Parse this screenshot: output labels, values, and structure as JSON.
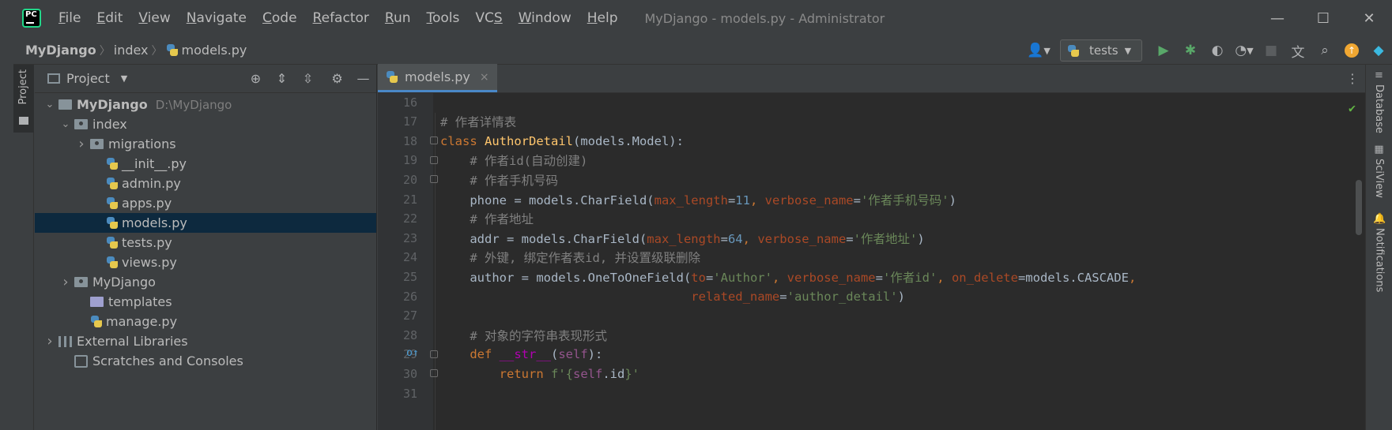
{
  "window": {
    "title": "MyDjango - models.py - Administrator",
    "controls": {
      "minimize": "—",
      "maximize": "☐",
      "close": "✕"
    }
  },
  "menu": [
    {
      "u": "F",
      "rest": "ile"
    },
    {
      "u": "E",
      "rest": "dit"
    },
    {
      "u": "V",
      "rest": "iew"
    },
    {
      "u": "N",
      "rest": "avigate"
    },
    {
      "u": "C",
      "rest": "ode"
    },
    {
      "u": "R",
      "rest": "efactor"
    },
    {
      "u": "R",
      "rest": "un"
    },
    {
      "u": "T",
      "rest": "ools"
    },
    {
      "pre": "VC",
      "u": "S",
      "rest": ""
    },
    {
      "u": "W",
      "rest": "indow"
    },
    {
      "u": "H",
      "rest": "elp"
    }
  ],
  "breadcrumb": {
    "project": "MyDjango",
    "folder": "index",
    "file": "models.py"
  },
  "run_config": {
    "label": "tests"
  },
  "left_strip": {
    "project_tab": "Project"
  },
  "project_panel": {
    "title": "Project",
    "tree": [
      {
        "indent": 0,
        "arrow": "down",
        "icon": "folder",
        "label": "MyDjango",
        "path": "D:\\MyDjango",
        "bold": true
      },
      {
        "indent": 1,
        "arrow": "down",
        "icon": "pkg",
        "label": "index"
      },
      {
        "indent": 2,
        "arrow": "right",
        "icon": "pkg",
        "label": "migrations"
      },
      {
        "indent": 3,
        "arrow": "",
        "icon": "py",
        "label": "__init__.py"
      },
      {
        "indent": 3,
        "arrow": "",
        "icon": "py",
        "label": "admin.py"
      },
      {
        "indent": 3,
        "arrow": "",
        "icon": "py",
        "label": "apps.py"
      },
      {
        "indent": 3,
        "arrow": "",
        "icon": "py",
        "label": "models.py",
        "selected": true
      },
      {
        "indent": 3,
        "arrow": "",
        "icon": "py",
        "label": "tests.py"
      },
      {
        "indent": 3,
        "arrow": "",
        "icon": "py",
        "label": "views.py"
      },
      {
        "indent": 1,
        "arrow": "right",
        "icon": "pkg",
        "label": "MyDjango"
      },
      {
        "indent": 2,
        "arrow": "",
        "icon": "tpl",
        "label": "templates"
      },
      {
        "indent": 2,
        "arrow": "",
        "icon": "py",
        "label": "manage.py"
      },
      {
        "indent": 0,
        "arrow": "right",
        "icon": "lib",
        "label": "External Libraries"
      },
      {
        "indent": 1,
        "arrow": "",
        "icon": "scratch",
        "label": "Scratches and Consoles"
      }
    ]
  },
  "editor": {
    "tab": {
      "label": "models.py",
      "close": "×"
    },
    "lines": [
      {
        "n": "16",
        "tokens": []
      },
      {
        "n": "17",
        "tokens": [
          {
            "c": "cmt",
            "t": "# 作者详情表"
          }
        ]
      },
      {
        "n": "18",
        "fold": true,
        "tokens": [
          {
            "c": "kw",
            "t": "class "
          },
          {
            "c": "cls",
            "t": "AuthorDetail"
          },
          {
            "c": "",
            "t": "(models.Model):"
          }
        ]
      },
      {
        "n": "19",
        "fold": true,
        "tokens": [
          {
            "c": "",
            "t": "    "
          },
          {
            "c": "cmt",
            "t": "# 作者id(自动创建)"
          }
        ]
      },
      {
        "n": "20",
        "fold": true,
        "tokens": [
          {
            "c": "",
            "t": "    "
          },
          {
            "c": "cmt",
            "t": "# 作者手机号码"
          }
        ]
      },
      {
        "n": "21",
        "tokens": [
          {
            "c": "",
            "t": "    phone = models.CharField("
          },
          {
            "c": "param",
            "t": "max_length"
          },
          {
            "c": "",
            "t": "="
          },
          {
            "c": "num",
            "t": "11"
          },
          {
            "c": "kw",
            "t": ", "
          },
          {
            "c": "param",
            "t": "verbose_name"
          },
          {
            "c": "",
            "t": "="
          },
          {
            "c": "str",
            "t": "'作者手机号码'"
          },
          {
            "c": "",
            "t": ")"
          }
        ]
      },
      {
        "n": "22",
        "tokens": [
          {
            "c": "",
            "t": "    "
          },
          {
            "c": "cmt",
            "t": "# 作者地址"
          }
        ]
      },
      {
        "n": "23",
        "tokens": [
          {
            "c": "",
            "t": "    addr = models.CharField("
          },
          {
            "c": "param",
            "t": "max_length"
          },
          {
            "c": "",
            "t": "="
          },
          {
            "c": "num",
            "t": "64"
          },
          {
            "c": "kw",
            "t": ", "
          },
          {
            "c": "param",
            "t": "verbose_name"
          },
          {
            "c": "",
            "t": "="
          },
          {
            "c": "str",
            "t": "'作者地址'"
          },
          {
            "c": "",
            "t": ")"
          }
        ]
      },
      {
        "n": "24",
        "tokens": [
          {
            "c": "",
            "t": "    "
          },
          {
            "c": "cmt",
            "t": "# 外键, 绑定作者表id, 并设置级联删除"
          }
        ]
      },
      {
        "n": "25",
        "tokens": [
          {
            "c": "",
            "t": "    author = models.OneToOneField("
          },
          {
            "c": "param",
            "t": "to"
          },
          {
            "c": "",
            "t": "="
          },
          {
            "c": "str",
            "t": "'Author'"
          },
          {
            "c": "kw",
            "t": ", "
          },
          {
            "c": "param",
            "t": "verbose_name"
          },
          {
            "c": "",
            "t": "="
          },
          {
            "c": "str",
            "t": "'作者id'"
          },
          {
            "c": "kw",
            "t": ", "
          },
          {
            "c": "param",
            "t": "on_delete"
          },
          {
            "c": "",
            "t": "=models.CASCADE"
          },
          {
            "c": "kw",
            "t": ","
          }
        ]
      },
      {
        "n": "26",
        "tokens": [
          {
            "c": "",
            "t": "                                  "
          },
          {
            "c": "param",
            "t": "related_name"
          },
          {
            "c": "",
            "t": "="
          },
          {
            "c": "str",
            "t": "'author_detail'"
          },
          {
            "c": "",
            "t": ")"
          }
        ]
      },
      {
        "n": "27",
        "tokens": []
      },
      {
        "n": "28",
        "tokens": [
          {
            "c": "",
            "t": "    "
          },
          {
            "c": "cmt",
            "t": "# 对象的字符串表现形式"
          }
        ]
      },
      {
        "n": "29",
        "fold": true,
        "mark": "o↑",
        "tokens": [
          {
            "c": "",
            "t": "    "
          },
          {
            "c": "kw",
            "t": "def "
          },
          {
            "c": "dunder",
            "t": "__str__"
          },
          {
            "c": "",
            "t": "("
          },
          {
            "c": "self",
            "t": "self"
          },
          {
            "c": "",
            "t": "):"
          }
        ]
      },
      {
        "n": "30",
        "fold": true,
        "tokens": [
          {
            "c": "",
            "t": "        "
          },
          {
            "c": "kw",
            "t": "return "
          },
          {
            "c": "str",
            "t": "f'{"
          },
          {
            "c": "self",
            "t": "self"
          },
          {
            "c": "",
            "t": ".id"
          },
          {
            "c": "str",
            "t": "}'"
          }
        ]
      },
      {
        "n": "31",
        "tokens": []
      }
    ]
  },
  "right_strip": [
    {
      "label": "Database",
      "icon": "≡"
    },
    {
      "label": "SciView",
      "icon": "▦"
    },
    {
      "label": "Notifications",
      "icon": "🔔"
    }
  ],
  "colors": {
    "accent": "#4a88c7",
    "selection": "#0d293e",
    "run_green": "#59a869"
  }
}
